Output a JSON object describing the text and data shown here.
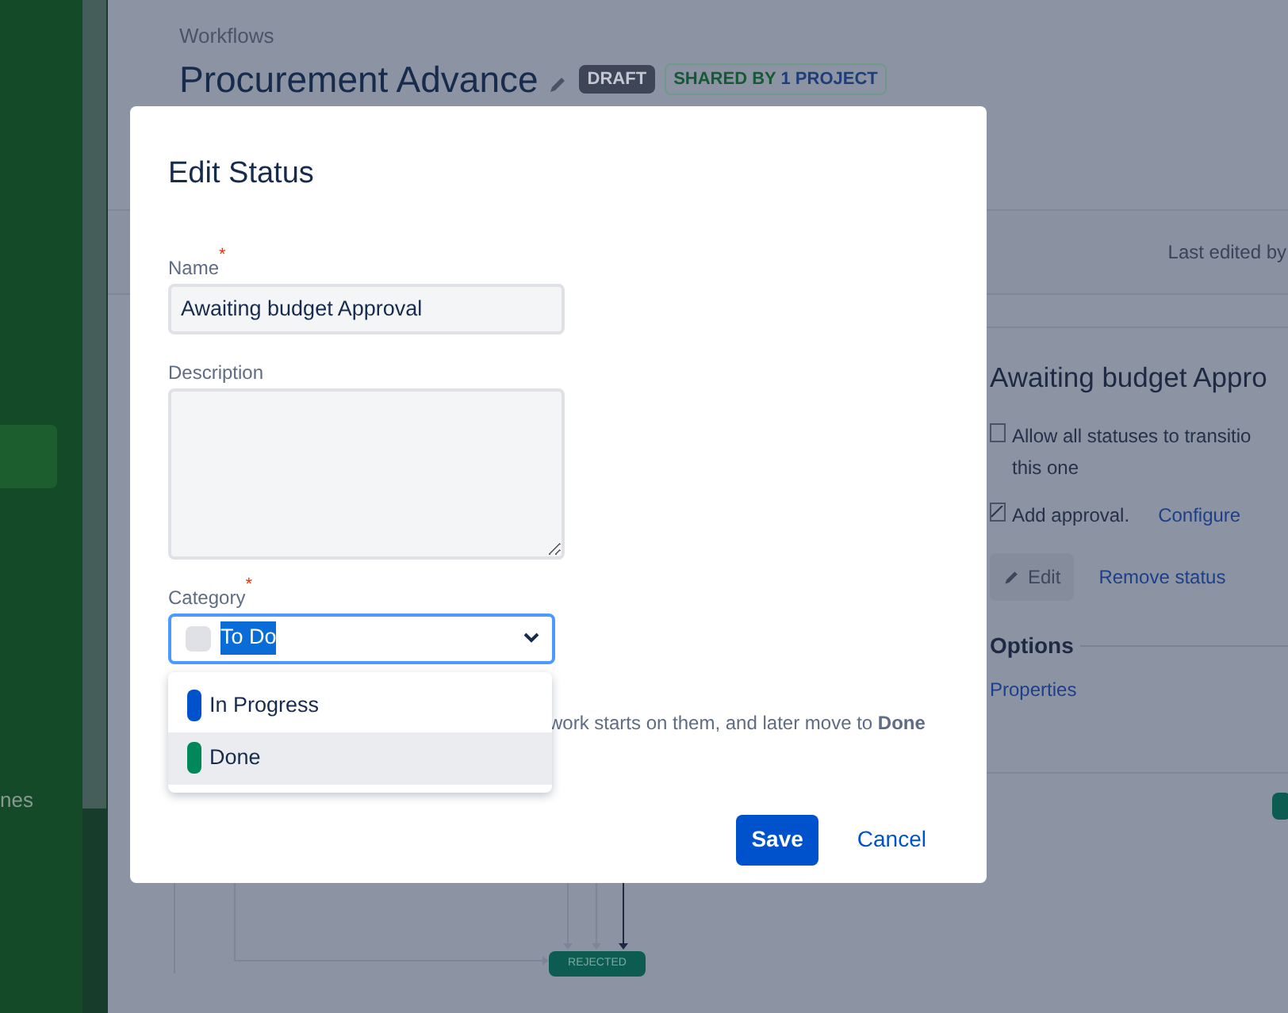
{
  "sidebar": {
    "items": [
      {
        "selected": true
      }
    ],
    "text_fragment": "nes"
  },
  "breadcrumb": "Workflows",
  "title": "Procurement Advance",
  "badges": [
    {
      "kind": "status",
      "parts": [
        "DRAFT"
      ]
    },
    {
      "kind": "shared",
      "parts": [
        "SHARED BY",
        "1 PROJECT"
      ]
    }
  ],
  "last_edited": "Last edited by",
  "status_panel": {
    "title": "Awaiting budget Appro",
    "options": [
      {
        "lines": [
          "Allow all statuses to transitio",
          "this one"
        ],
        "checked": false
      },
      {
        "lines": [
          "Add approval."
        ],
        "checked": true,
        "link": "Configure"
      }
    ],
    "buttons": [
      {
        "kind": "edit",
        "label": "Edit"
      },
      {
        "kind": "link",
        "label": "Remove status"
      }
    ],
    "section": "Options",
    "section_link": "Properties"
  },
  "diagram": {
    "node": "REJECTED"
  },
  "modal": {
    "title": "Edit Status",
    "fields": [
      {
        "kind": "text",
        "label": "Name",
        "required_mark": "*",
        "value": "Awaiting budget Approval"
      },
      {
        "kind": "textarea",
        "label": "Description"
      },
      {
        "kind": "select",
        "label": "Category",
        "required_mark": "*",
        "value": "To Do",
        "color": "#dfe1e6"
      }
    ],
    "options": [
      {
        "label": "In Progress",
        "color": "#0052cc",
        "selected": false
      },
      {
        "label": "Done",
        "color": "#00875a",
        "selected": true
      }
    ],
    "help": "work starts on them, and later move to **Done**",
    "buttons": [
      {
        "kind": "primary",
        "label": "Save"
      },
      {
        "kind": "link",
        "label": "Cancel"
      }
    ]
  }
}
